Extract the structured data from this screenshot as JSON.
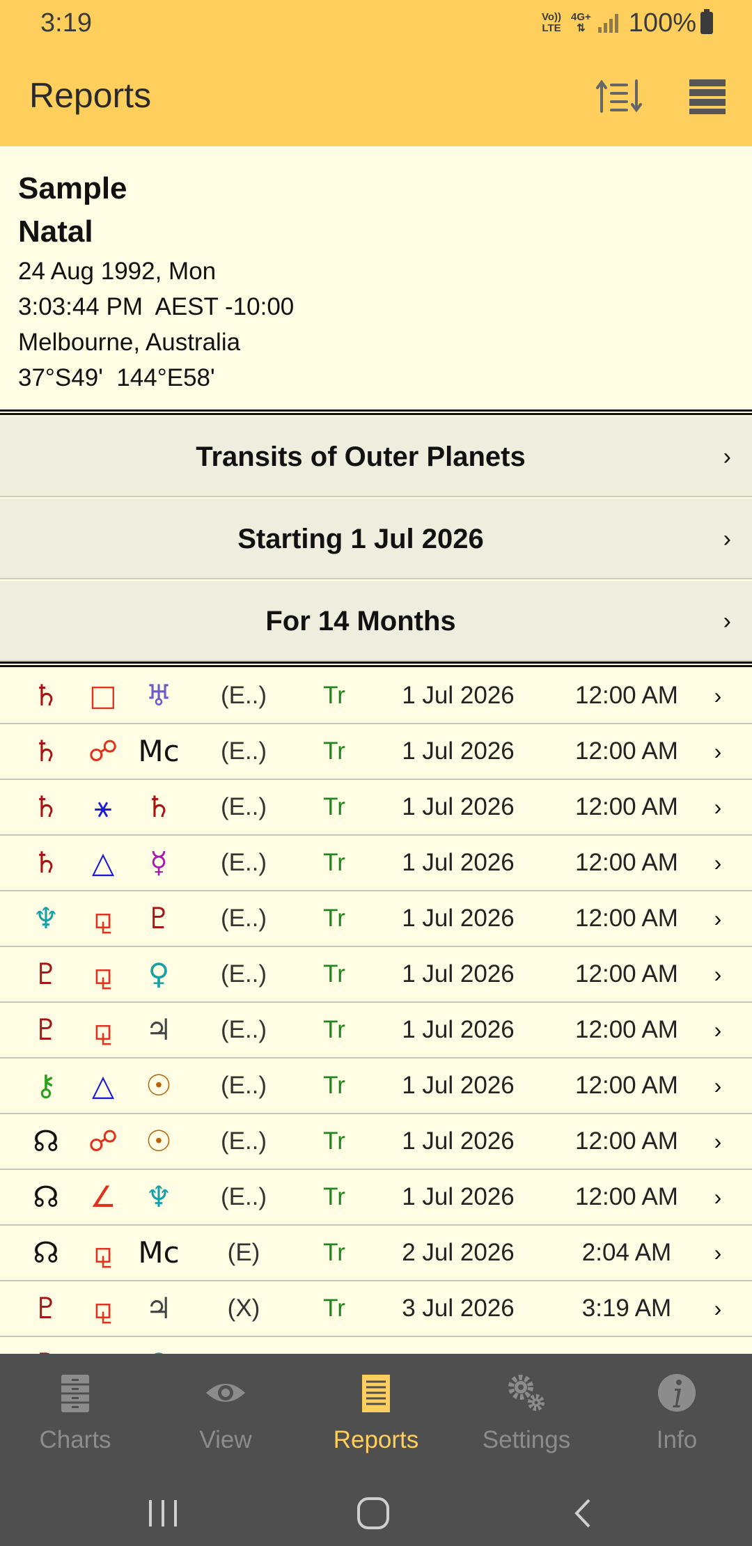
{
  "status": {
    "time": "3:19",
    "net_top": "Vo))",
    "net_bottom": "LTE",
    "net2_top": "4G+",
    "net2_bottom": "⇅",
    "battery": "100%"
  },
  "appbar": {
    "title": "Reports",
    "sort_icon": "sort-icon",
    "menu_icon": "menu-icon"
  },
  "chart": {
    "name": "Sample",
    "type": "Natal",
    "date": "24 Aug 1992, Mon",
    "time": "3:03:44 PM  AEST -10:00",
    "place": "Melbourne, Australia",
    "coords": "37°S49'  144°E58'"
  },
  "options": [
    {
      "label": "Transits of Outer Planets",
      "chevron": "›"
    },
    {
      "label": "Starting 1 Jul 2026",
      "chevron": "›"
    },
    {
      "label": "For 14 Months",
      "chevron": "›"
    }
  ],
  "colors": {
    "saturn": "#a51515",
    "square": "#e0321e",
    "uranus": "#6a5acd",
    "opposition": "#e0321e",
    "sextile": "#1a1ae0",
    "trine": "#1a1ae0",
    "mercury": "#a51ab0",
    "neptune": "#18a0a8",
    "pluto": "#a51515",
    "venus": "#18a0a8",
    "jupiter": "#444444",
    "chiron": "#2aa01a",
    "sun": "#b8640a",
    "node": "#111111",
    "mc": "#111111",
    "semisquare": "#e0321e",
    "sesqui": "#e0321e"
  },
  "rows": [
    {
      "p1": "♄",
      "c1": "#a51515",
      "asp": "□",
      "ca": "#e0321e",
      "p2": "♅",
      "c2": "#6a5acd",
      "code": "(E..)",
      "type": "Tr",
      "date": "1 Jul 2026",
      "time": "12:00 AM",
      "chev": "›"
    },
    {
      "p1": "♄",
      "c1": "#a51515",
      "asp": "☍",
      "ca": "#e0321e",
      "p2": "Mc",
      "c2": "#111111",
      "code": "(E..)",
      "type": "Tr",
      "date": "1 Jul 2026",
      "time": "12:00 AM",
      "chev": "›"
    },
    {
      "p1": "♄",
      "c1": "#a51515",
      "asp": "⚹",
      "ca": "#1a1ae0",
      "p2": "♄",
      "c2": "#a51515",
      "code": "(E..)",
      "type": "Tr",
      "date": "1 Jul 2026",
      "time": "12:00 AM",
      "chev": "›"
    },
    {
      "p1": "♄",
      "c1": "#a51515",
      "asp": "△",
      "ca": "#1a1ae0",
      "p2": "☿",
      "c2": "#a51ab0",
      "code": "(E..)",
      "type": "Tr",
      "date": "1 Jul 2026",
      "time": "12:00 AM",
      "chev": "›"
    },
    {
      "p1": "♆",
      "c1": "#18a0a8",
      "asp": "⚼",
      "ca": "#e0321e",
      "p2": "♇",
      "c2": "#a51515",
      "code": "(E..)",
      "type": "Tr",
      "date": "1 Jul 2026",
      "time": "12:00 AM",
      "chev": "›"
    },
    {
      "p1": "♇",
      "c1": "#a51515",
      "asp": "⚼",
      "ca": "#e0321e",
      "p2": "♀",
      "c2": "#18a0a8",
      "code": "(E..)",
      "type": "Tr",
      "date": "1 Jul 2026",
      "time": "12:00 AM",
      "chev": "›"
    },
    {
      "p1": "♇",
      "c1": "#a51515",
      "asp": "⚼",
      "ca": "#e0321e",
      "p2": "♃",
      "c2": "#444444",
      "code": "(E..)",
      "type": "Tr",
      "date": "1 Jul 2026",
      "time": "12:00 AM",
      "chev": "›"
    },
    {
      "p1": "⚷",
      "c1": "#2aa01a",
      "asp": "△",
      "ca": "#1a1ae0",
      "p2": "☉",
      "c2": "#b8640a",
      "code": "(E..)",
      "type": "Tr",
      "date": "1 Jul 2026",
      "time": "12:00 AM",
      "chev": "›"
    },
    {
      "p1": "☊",
      "c1": "#111111",
      "asp": "☍",
      "ca": "#e0321e",
      "p2": "☉",
      "c2": "#b8640a",
      "code": "(E..)",
      "type": "Tr",
      "date": "1 Jul 2026",
      "time": "12:00 AM",
      "chev": "›"
    },
    {
      "p1": "☊",
      "c1": "#111111",
      "asp": "∠",
      "ca": "#e0321e",
      "p2": "♆",
      "c2": "#18a0a8",
      "code": "(E..)",
      "type": "Tr",
      "date": "1 Jul 2026",
      "time": "12:00 AM",
      "chev": "›"
    },
    {
      "p1": "☊",
      "c1": "#111111",
      "asp": "⚼",
      "ca": "#e0321e",
      "p2": "Mc",
      "c2": "#111111",
      "code": "(E)",
      "type": "Tr",
      "date": "2 Jul 2026",
      "time": "2:04 AM",
      "chev": "›"
    },
    {
      "p1": "♇",
      "c1": "#a51515",
      "asp": "⚼",
      "ca": "#e0321e",
      "p2": "♃",
      "c2": "#444444",
      "code": "(X)",
      "type": "Tr",
      "date": "3 Jul 2026",
      "time": "3:19 AM",
      "chev": "›"
    },
    {
      "p1": "♇",
      "c1": "#a51515",
      "asp": "⚼",
      "ca": "#e0321e",
      "p2": "♀",
      "c2": "#18a0a8",
      "code": "",
      "type": "",
      "date": "",
      "time": "",
      "chev": ""
    }
  ],
  "bottom_nav": [
    {
      "label": "Charts",
      "icon": "charts-icon",
      "active": false
    },
    {
      "label": "View",
      "icon": "eye-icon",
      "active": false
    },
    {
      "label": "Reports",
      "icon": "reports-icon",
      "active": true
    },
    {
      "label": "Settings",
      "icon": "gear-icon",
      "active": false
    },
    {
      "label": "Info",
      "icon": "info-icon",
      "active": false
    }
  ],
  "accent_color": "#ffcf5e"
}
